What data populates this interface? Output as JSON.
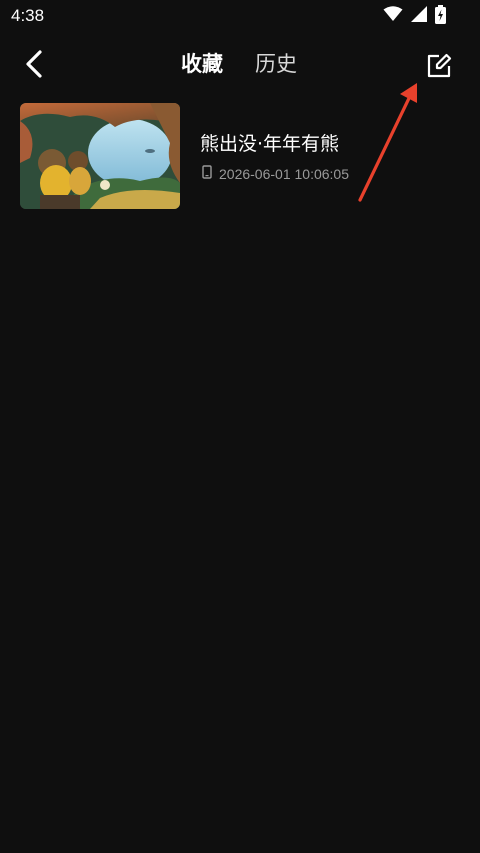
{
  "status_bar": {
    "time": "4:38",
    "icons": [
      "wifi-icon",
      "signal-icon",
      "battery-charging-icon"
    ]
  },
  "header": {
    "back_icon": "chevron-left-icon",
    "tabs": [
      {
        "label": "收藏",
        "active": true
      },
      {
        "label": "历史",
        "active": false
      }
    ],
    "edit_icon": "edit-icon"
  },
  "items": [
    {
      "title": "熊出没·年年有熊",
      "device_icon": "phone-icon",
      "timestamp": "2026-06-01 10:06:05"
    }
  ],
  "colors": {
    "background": "#0f0f0f",
    "meta_text": "#9a9a9a",
    "annotation_arrow": "#e8412c",
    "tab_indicator_start": "#ffb300",
    "tab_indicator_end": "#7b6cff"
  }
}
